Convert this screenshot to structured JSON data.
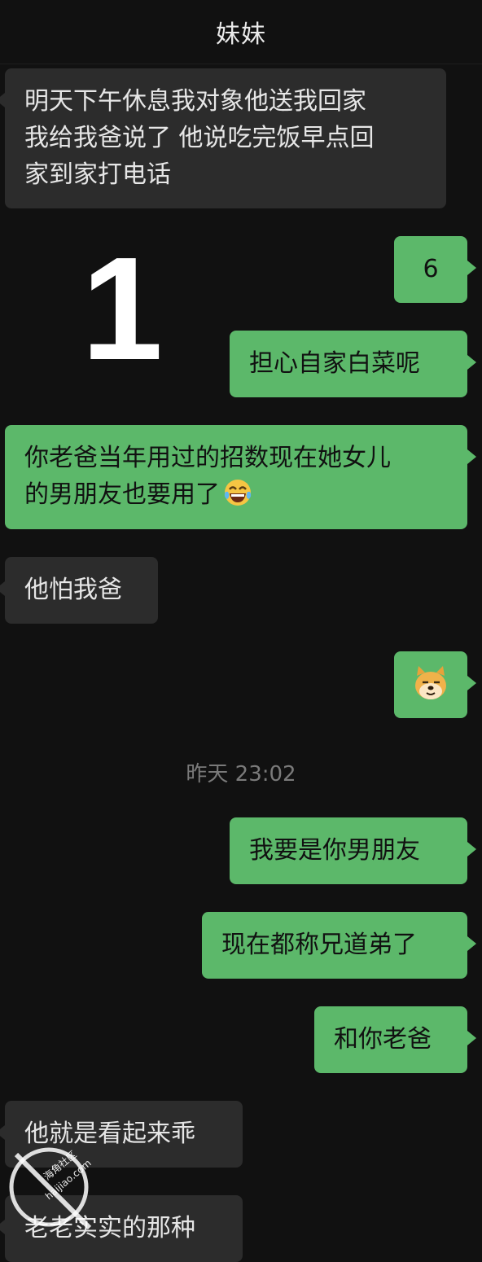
{
  "header": {
    "title": "妹妹"
  },
  "overlay_label": "1",
  "messages": [
    {
      "side": "in",
      "text": "明天下午休息我对象他送我回家\n我给我爸说了 他说吃完饭早点回\n家到家打电话"
    },
    {
      "side": "out",
      "text": "6"
    },
    {
      "side": "out",
      "text": "担心自家白菜呢"
    },
    {
      "side": "out",
      "text": "你老爸当年用过的招数现在她女儿\n的男朋友也要用了",
      "emoji": "laugh-cry-emoji"
    },
    {
      "side": "in",
      "text": "他怕我爸"
    },
    {
      "side": "out",
      "sticker": "doge-emoji"
    },
    {
      "side": "out",
      "text": "我要是你男朋友"
    },
    {
      "side": "out",
      "text": "现在都称兄道弟了"
    },
    {
      "side": "out",
      "text": "和你老爸"
    },
    {
      "side": "in",
      "text": "他就是看起来乖"
    },
    {
      "side": "in",
      "text": "老老实实的那种"
    }
  ],
  "timestamp": "昨天 23:02",
  "watermark": {
    "text": "海角社区",
    "domain": "haijiao.com"
  },
  "colors": {
    "background": "#111111",
    "incoming": "#2c2c2c",
    "outgoing": "#5cb86a"
  }
}
